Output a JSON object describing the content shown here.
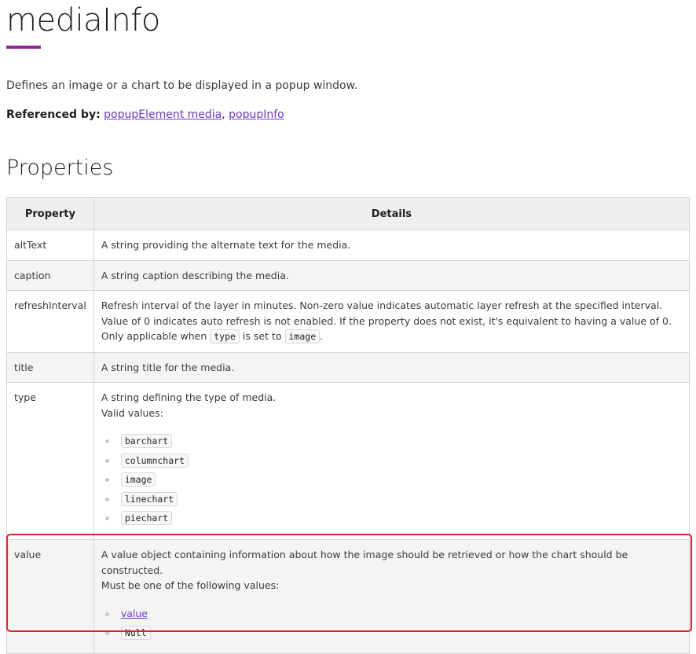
{
  "page": {
    "title": "mediaInfo",
    "description": "Defines an image or a chart to be displayed in a popup window.",
    "referenced_by_label": "Referenced by:",
    "referenced_by_links": [
      "popupElement media",
      "popupInfo"
    ],
    "referenced_by_separator": ", ",
    "properties_heading": "Properties",
    "accent_color": "#8a2c8f",
    "link_color": "#6e37c8",
    "highlight_color": "#d9232a"
  },
  "table": {
    "headers": [
      "Property",
      "Details"
    ],
    "rows": {
      "altText": {
        "name": "altText",
        "details": "A string providing the alternate text for the media."
      },
      "caption": {
        "name": "caption",
        "details": "A string caption describing the media."
      },
      "refreshInterval": {
        "name": "refreshInterval",
        "details_pre": "Refresh interval of the layer in minutes. Non-zero value indicates automatic layer refresh at the specified interval. Value of 0 indicates auto refresh is not enabled. If the property does not exist, it's equivalent to having a value of 0. Only applicable when ",
        "code1": "type",
        "details_mid": " is set to ",
        "code2": "image",
        "details_post": "."
      },
      "title": {
        "name": "title",
        "details": "A string title for the media."
      },
      "type": {
        "name": "type",
        "details_line1": "A string defining the type of media.",
        "details_line2": "Valid values:",
        "values": [
          "barchart",
          "columnchart",
          "image",
          "linechart",
          "piechart"
        ]
      },
      "value": {
        "name": "value",
        "details_line1": "A value object containing information about how the image should be retrieved or how the chart should be constructed.",
        "details_line2": "Must be one of the following values:",
        "link_value": "value",
        "code_value": "Null"
      }
    }
  }
}
